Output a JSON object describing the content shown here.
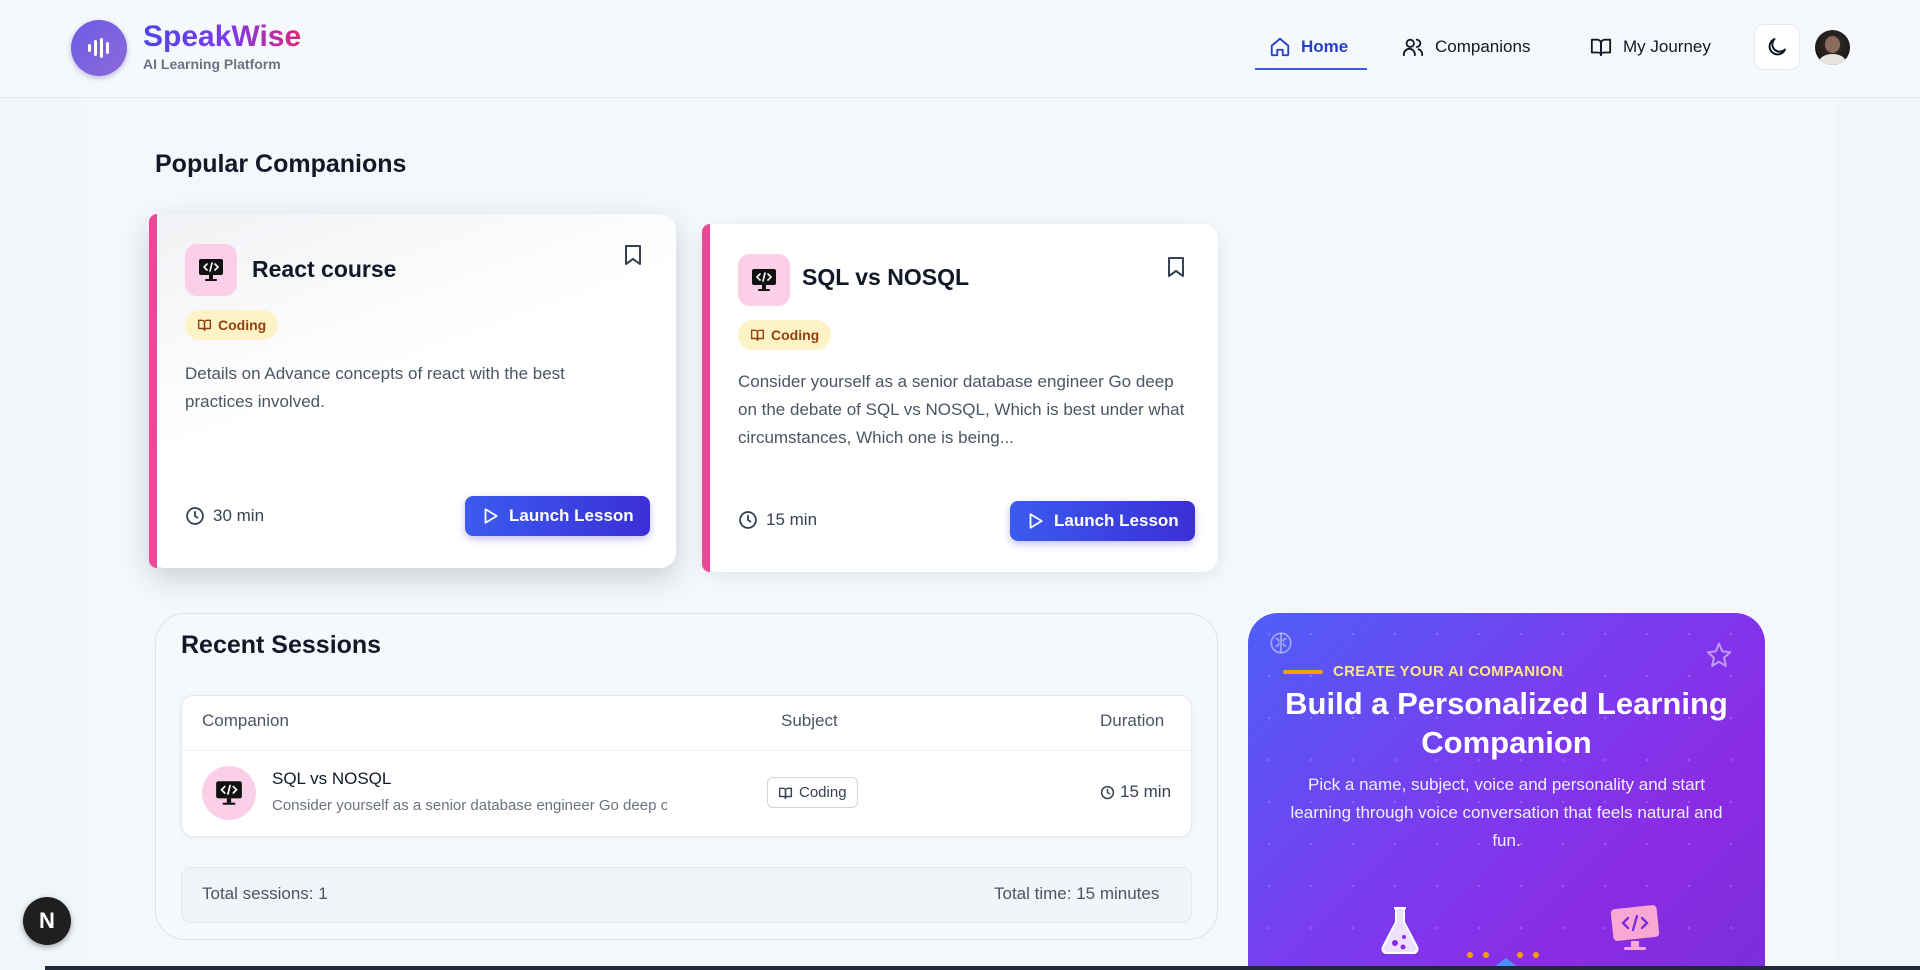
{
  "brand": {
    "name": "SpeakWise",
    "tagline": "AI Learning Platform"
  },
  "nav": {
    "items": [
      {
        "label": "Home",
        "icon": "home-icon",
        "active": true
      },
      {
        "label": "Companions",
        "icon": "users-icon",
        "active": false
      },
      {
        "label": "My Journey",
        "icon": "book-open-icon",
        "active": false
      }
    ],
    "theme_toggle_icon": "moon-icon"
  },
  "popular": {
    "title": "Popular Companions",
    "cards": [
      {
        "name": "React course",
        "subject": "Coding",
        "description": "Details on Advance concepts of react with the best practices involved.",
        "duration": "30 min",
        "action": "Launch Lesson"
      },
      {
        "name": "SQL vs NOSQL",
        "subject": "Coding",
        "description": "Consider yourself as a senior database engineer Go deep on the debate of SQL vs NOSQL, Which is best under what circumstances, Which one is being...",
        "duration": "15 min",
        "action": "Launch Lesson"
      }
    ]
  },
  "sessions": {
    "title": "Recent Sessions",
    "columns": [
      "Companion",
      "Subject",
      "Duration"
    ],
    "rows": [
      {
        "name": "SQL vs NOSQL",
        "description": "Consider yourself as a senior database engineer Go deep on the debate of SQL vs NOSQL",
        "subject": "Coding",
        "duration": "15 min"
      }
    ],
    "total_sessions": "Total sessions: 1",
    "total_time": "Total time: 15 minutes"
  },
  "cta": {
    "eyebrow": "CREATE YOUR AI COMPANION",
    "title": "Build a Personalized Learning Companion",
    "text": "Pick a name, subject, voice and personality and start learning through voice conversation that feels natural and fun."
  },
  "dev_badge": "N",
  "colors": {
    "accent": "#3b5bdb",
    "card_accent": "#ec4899",
    "chip_bg": "#fef3c7",
    "button": "#3b2fd6"
  }
}
